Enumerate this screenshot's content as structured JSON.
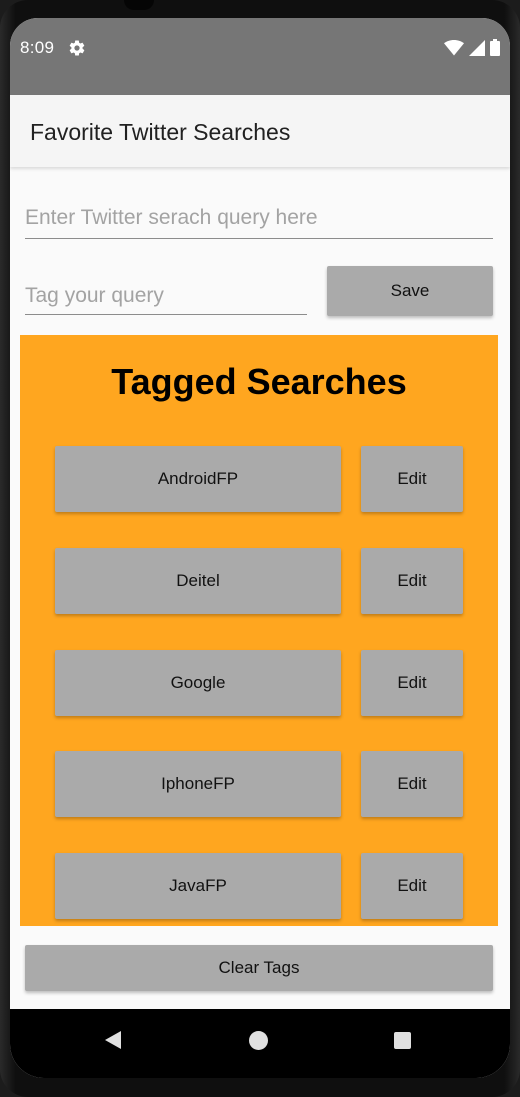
{
  "status_bar": {
    "time": "8:09",
    "icons": [
      "settings-gear",
      "wifi",
      "signal",
      "battery"
    ]
  },
  "app_bar": {
    "title": "Favorite Twitter Searches"
  },
  "form": {
    "query_placeholder": "Enter Twitter serach query here",
    "query_value": "",
    "tag_placeholder": "Tag your query",
    "tag_value": "",
    "save_label": "Save"
  },
  "tagged": {
    "title": "Tagged Searches",
    "items": [
      {
        "tag": "AndroidFP",
        "edit_label": "Edit"
      },
      {
        "tag": "Deitel",
        "edit_label": "Edit"
      },
      {
        "tag": "Google",
        "edit_label": "Edit"
      },
      {
        "tag": "IphoneFP",
        "edit_label": "Edit"
      },
      {
        "tag": "JavaFP",
        "edit_label": "Edit"
      }
    ]
  },
  "clear_label": "Clear Tags",
  "nav": {
    "buttons": [
      "back",
      "home",
      "recents"
    ]
  },
  "colors": {
    "status_bar": "#767676",
    "panel": "#ffa61f",
    "button": "#aaaaaa",
    "background": "#fafafa"
  }
}
